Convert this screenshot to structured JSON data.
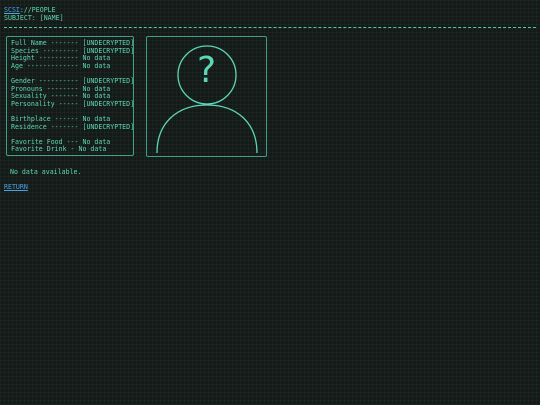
{
  "header": {
    "path_link": "SCSI",
    "path_rest": "://PEOPLE",
    "subject": "SUBJECT: [NAME]"
  },
  "profile": {
    "groups": [
      {
        "rows": [
          {
            "label": "Full Name -------",
            "value": "[UNDECRYPTED]"
          },
          {
            "label": "Species ---------",
            "value": "[UNDECRYPTED]"
          },
          {
            "label": "Height ----------",
            "value": "No data"
          },
          {
            "label": "Age -------------",
            "value": "No data"
          }
        ]
      },
      {
        "rows": [
          {
            "label": "Gender ----------",
            "value": "[UNDECRYPTED]"
          },
          {
            "label": "Pronouns --------",
            "value": "No data"
          },
          {
            "label": "Sexuality -------",
            "value": "No data"
          },
          {
            "label": "Personality -----",
            "value": "[UNDECRYPTED]"
          }
        ]
      },
      {
        "rows": [
          {
            "label": "Birthplace ------",
            "value": "No data"
          },
          {
            "label": "Residence -------",
            "value": "[UNDECRYPTED]"
          }
        ]
      },
      {
        "rows": [
          {
            "label": "Favorite Food ---",
            "value": "No data"
          },
          {
            "label": "Favorite Drink -",
            "value": "No data"
          }
        ]
      }
    ]
  },
  "portrait": {
    "glyph": "?",
    "icon": "unknown-person-silhouette"
  },
  "body_text": "No data available.",
  "return_label": "RETURN",
  "colors": {
    "background": "#141a17",
    "text": "#5ed6b6",
    "border": "#3f9f87",
    "link": "#4aa3e6"
  }
}
